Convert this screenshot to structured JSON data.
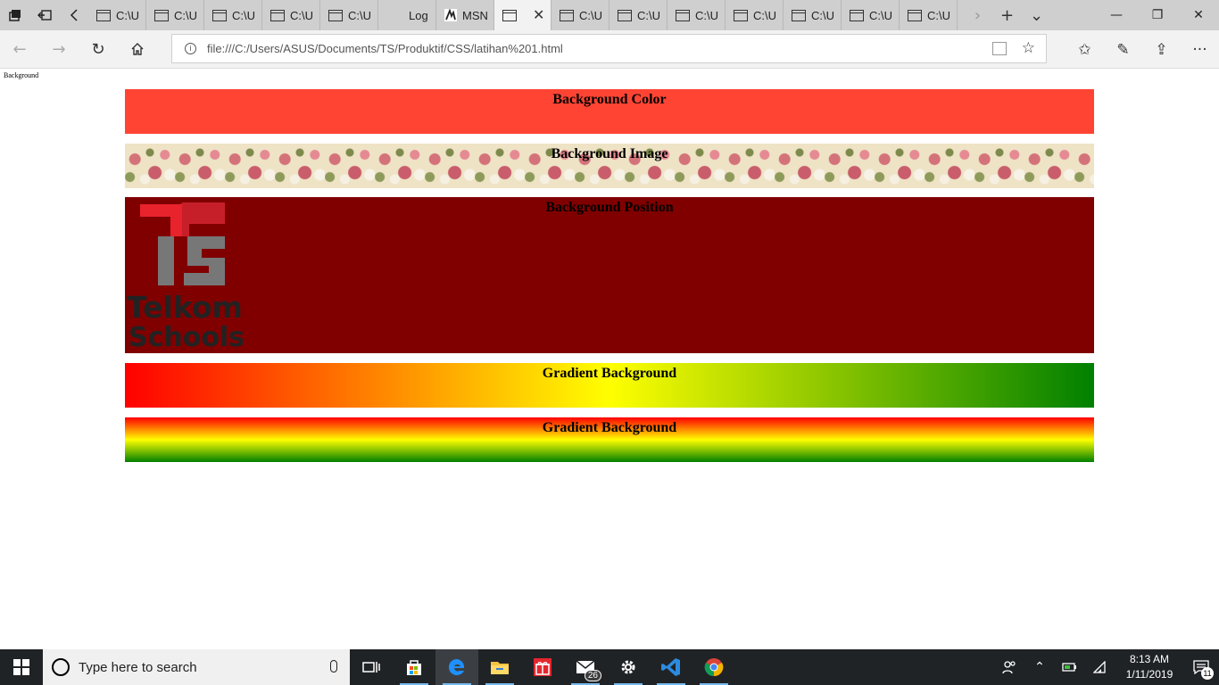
{
  "browser": {
    "tabs": [
      {
        "label": "C:\\U"
      },
      {
        "label": "C:\\U"
      },
      {
        "label": "C:\\U"
      },
      {
        "label": "C:\\U"
      },
      {
        "label": "C:\\U"
      },
      {
        "label": "Log"
      },
      {
        "label": "MSN"
      },
      {
        "label": ""
      },
      {
        "label": "C:\\U"
      },
      {
        "label": "C:\\U"
      },
      {
        "label": "C:\\U"
      },
      {
        "label": "C:\\U"
      },
      {
        "label": "C:\\U"
      },
      {
        "label": "C:\\U"
      },
      {
        "label": "C:\\U"
      }
    ],
    "address_url": "file:///C:/Users/ASUS/Documents/TS/Produktif/CSS/latihan%201.html"
  },
  "page": {
    "title": "Background",
    "boxes": {
      "color": "Background Color",
      "image": "Background Image",
      "position": "Background Position",
      "gradient_h": "Gradient Background",
      "gradient_v": "Gradient Background"
    },
    "logo": {
      "line1": "Telkom",
      "line2": "Schools"
    },
    "colors": {
      "bg_color": "#ff4433",
      "position_bg": "#800000"
    }
  },
  "taskbar": {
    "search_placeholder": "Type here to search",
    "mail_badge": "26",
    "clock_time": "8:13 AM",
    "clock_date": "1/11/2019",
    "notification_count": "11"
  }
}
